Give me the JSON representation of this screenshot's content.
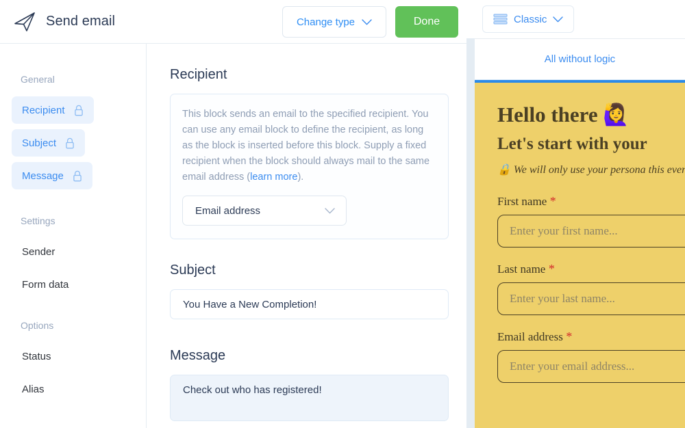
{
  "editor": {
    "topbar": {
      "icon": "paper-plane-icon",
      "title": "Send email",
      "change_type_label": "Change type",
      "done_label": "Done"
    },
    "sidebar": {
      "groups": [
        {
          "label": "General",
          "items": [
            {
              "label": "Recipient",
              "locked": true,
              "active": true
            },
            {
              "label": "Subject",
              "locked": true,
              "active": true
            },
            {
              "label": "Message",
              "locked": true,
              "active": true
            }
          ]
        },
        {
          "label": "Settings",
          "items": [
            {
              "label": "Sender",
              "locked": false,
              "active": false
            },
            {
              "label": "Form data",
              "locked": false,
              "active": false
            }
          ]
        },
        {
          "label": "Options",
          "items": [
            {
              "label": "Status",
              "locked": false,
              "active": false
            },
            {
              "label": "Alias",
              "locked": false,
              "active": false
            }
          ]
        }
      ]
    },
    "main": {
      "recipient": {
        "title": "Recipient",
        "description_part1": "This block sends an email to the specified recipient. You can use any email block to define the recipient, as long as the block is inserted before this block. Supply a fixed recipient when the block should always mail to the same email address (",
        "learn_more": "learn more",
        "description_part2": ").",
        "select_value": "Email address"
      },
      "subject": {
        "title": "Subject",
        "value": "You Have a New Completion!"
      },
      "message": {
        "title": "Message",
        "value": "Check out who has registered!"
      }
    }
  },
  "preview": {
    "theme_button": {
      "icon": "stacked-bars-icon",
      "label": "Classic"
    },
    "tab_label": "All without logic",
    "form": {
      "heading": "Hello there 🙋‍♀️",
      "subheading": "Let's start with your",
      "note": "🔒 We will only use your persona this event.",
      "fields": [
        {
          "label": "First name",
          "required": true,
          "placeholder": "Enter your first name..."
        },
        {
          "label": "Last name",
          "required": true,
          "placeholder": "Enter your last name..."
        },
        {
          "label": "Email address",
          "required": true,
          "placeholder": "Enter your email address..."
        }
      ]
    }
  },
  "colors": {
    "accent_blue": "#3b8cf0",
    "done_green": "#61c159",
    "form_yellow": "#eed06a",
    "rule_blue": "#2b8ae8",
    "required_red": "#d32b2b"
  }
}
